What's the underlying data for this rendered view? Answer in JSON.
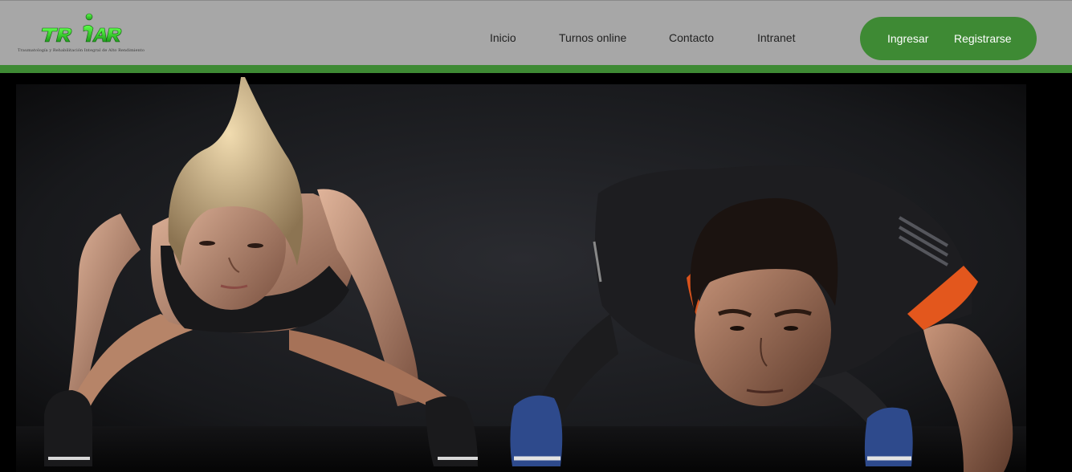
{
  "logo": {
    "brand": "TRIAR",
    "tagline": "Traumatología y Rehabilitación Integral de Alto Rendimiento"
  },
  "nav": {
    "items": [
      {
        "label": "Inicio"
      },
      {
        "label": "Turnos online"
      },
      {
        "label": "Contacto"
      },
      {
        "label": "Intranet"
      }
    ]
  },
  "auth": {
    "login_label": "Ingresar",
    "register_label": "Registrarse"
  },
  "colors": {
    "header_bg": "#a7a7a7",
    "accent_green": "#3e8a34",
    "logo_green": "#2fd12c"
  },
  "hero": {
    "image_description": "two-people-doing-push-ups-photo"
  }
}
